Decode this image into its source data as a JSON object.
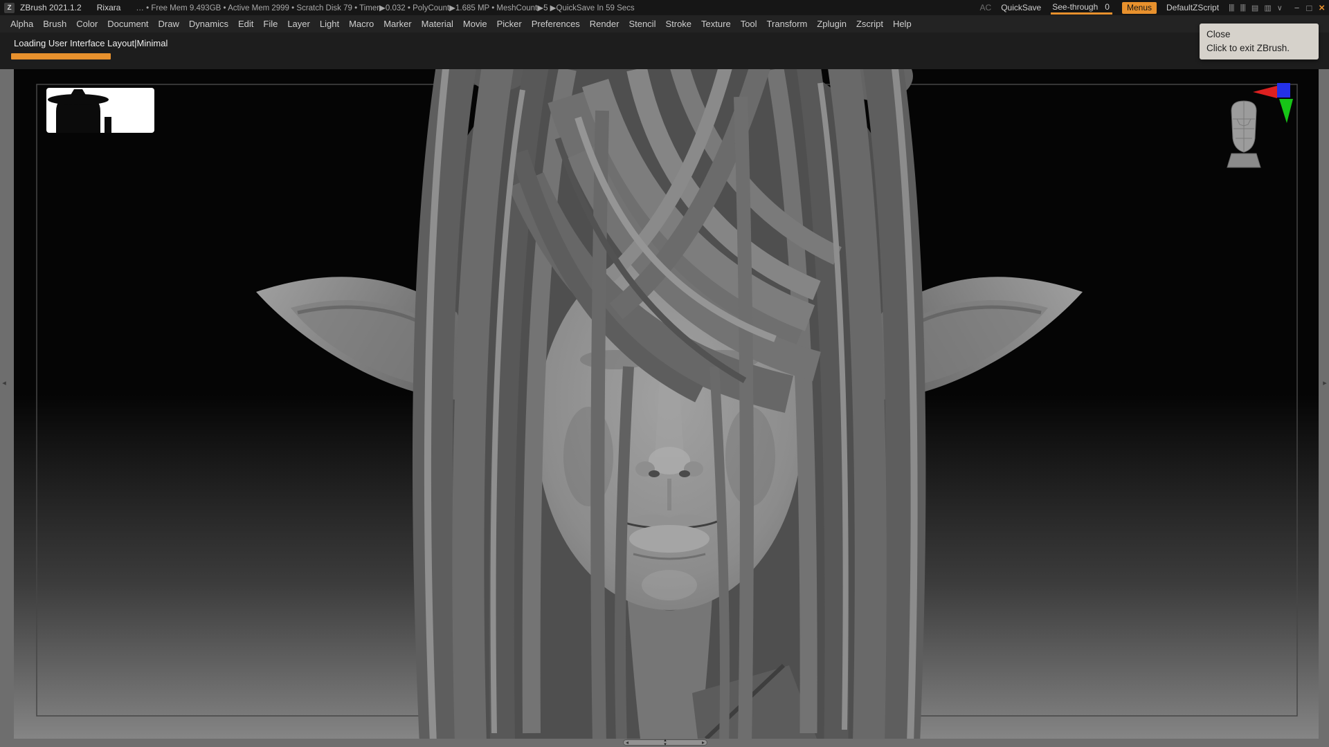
{
  "colors": {
    "accent": "#e8912d",
    "titlebar_bg": "#161616",
    "menubar_bg": "#232323",
    "canvas_bg": "#050505",
    "frame_gray": "#6e6e6e",
    "tooltip_bg": "#d6d2cb",
    "axis_x": "#dd2020",
    "axis_y": "#17c517",
    "axis_z": "#2431e8"
  },
  "titlebar": {
    "app_title": "ZBrush 2021.1.2",
    "document_name": "Rixara",
    "stats": "… • Free Mem 9.493GB • Active Mem 2999 • Scratch Disk 79 • Timer▶0.032 • PolyCount▶1.685 MP • MeshCount▶5 ▶QuickSave In 59 Secs",
    "ac": "AC",
    "quicksave": "QuickSave",
    "see_through_label": "See-through",
    "see_through_value": "0",
    "menus": "Menus",
    "zscript": "DefaultZScript",
    "icons": {
      "slider_a": "||||",
      "slider_b": "||||",
      "panel_a": "▤",
      "panel_b": "▥",
      "collapse": "∨",
      "minimize": "−",
      "maximize": "□",
      "close": "×"
    }
  },
  "menubar": {
    "items": [
      "Alpha",
      "Brush",
      "Color",
      "Document",
      "Draw",
      "Dynamics",
      "Edit",
      "File",
      "Layer",
      "Light",
      "Macro",
      "Marker",
      "Material",
      "Movie",
      "Picker",
      "Preferences",
      "Render",
      "Stencil",
      "Stroke",
      "Texture",
      "Tool",
      "Transform",
      "Zplugin",
      "Zscript",
      "Help"
    ]
  },
  "loading": {
    "text": "Loading User Interface Layout|Minimal",
    "progress_percent": 7.5
  },
  "tooltip": {
    "title": "Close",
    "body": "Click to exit ZBrush."
  },
  "scrollbar": {
    "left": "◂",
    "right": "▸",
    "up": "▴",
    "down": "▾"
  },
  "edge_handles": {
    "left": "◂",
    "right": "▸"
  }
}
